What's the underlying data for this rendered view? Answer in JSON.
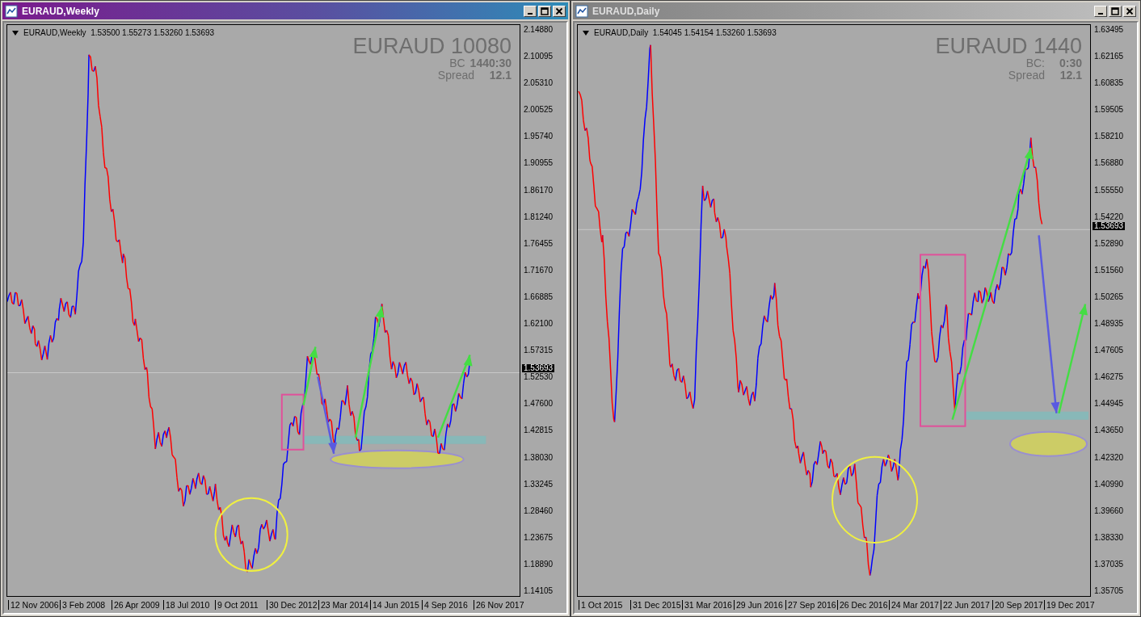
{
  "windows": [
    {
      "title": "EURAUD,Weekly",
      "active": true,
      "info": "EURAUD,Weekly  1.53500 1.55273 1.53260 1.53693",
      "symbol": "EURAUD 10080",
      "bc_label": "BC",
      "bc_value": "1440:30",
      "spread_label": "Spread",
      "spread_value": "12.1",
      "current_price": "1.53693",
      "price_ticks": [
        "2.14880",
        "2.10095",
        "2.05310",
        "2.00525",
        "1.95740",
        "1.90955",
        "1.86170",
        "1.81240",
        "1.76455",
        "1.71670",
        "1.66885",
        "1.62100",
        "1.57315",
        "1.52530",
        "1.47600",
        "1.42815",
        "1.38030",
        "1.33245",
        "1.28460",
        "1.23675",
        "1.18890",
        "1.14105"
      ],
      "dates": [
        "12 Nov 2006",
        "3 Feb 2008",
        "26 Apr 2009",
        "18 Jul 2010",
        "9 Oct 2011",
        "30 Dec 2012",
        "23 Mar 2014",
        "14 Jun 2015",
        "4 Sep 2016",
        "26 Nov 2017"
      ]
    },
    {
      "title": "EURAUD,Daily",
      "active": false,
      "info": "EURAUD,Daily  1.54045 1.54154 1.53260 1.53693",
      "symbol": "EURAUD 1440",
      "bc_label": "BC:",
      "bc_value": "0:30",
      "spread_label": "Spread",
      "spread_value": "12.1",
      "current_price": "1.53693",
      "price_ticks": [
        "1.63495",
        "1.62165",
        "1.60835",
        "1.59505",
        "1.58210",
        "1.56880",
        "1.55550",
        "1.54220",
        "1.52890",
        "1.51560",
        "1.50265",
        "1.48935",
        "1.47605",
        "1.46275",
        "1.44945",
        "1.43650",
        "1.42320",
        "1.40990",
        "1.39660",
        "1.38330",
        "1.37035",
        "1.35705"
      ],
      "dates": [
        "1 Oct 2015",
        "31 Dec 2015",
        "31 Mar 2016",
        "29 Jun 2016",
        "27 Sep 2016",
        "26 Dec 2016",
        "24 Mar 2017",
        "22 Jun 2017",
        "20 Sep 2017",
        "19 Dec 2017"
      ]
    }
  ]
}
